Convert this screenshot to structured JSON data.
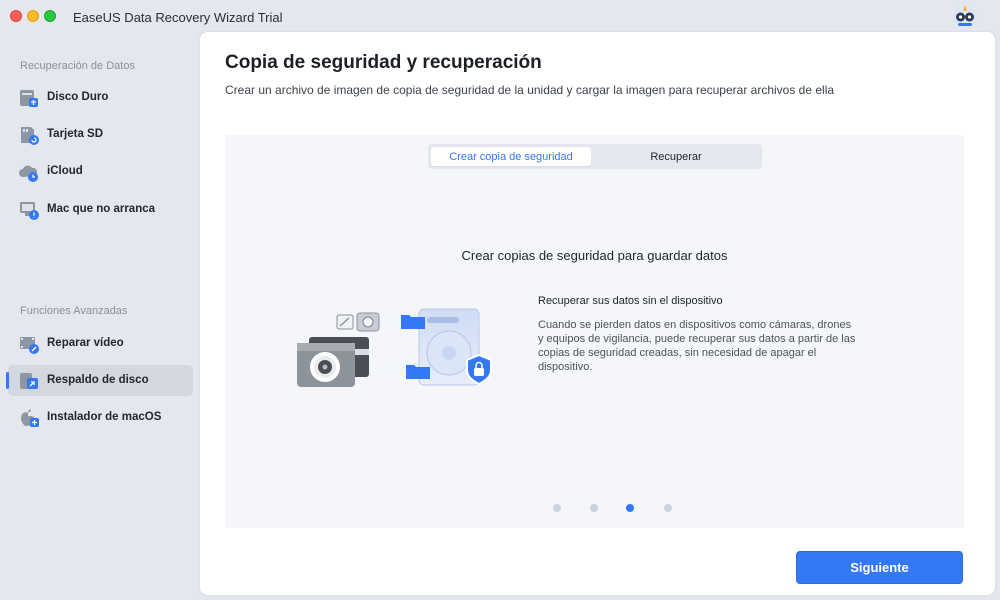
{
  "app": {
    "title": "EaseUS Data Recovery Wizard  Trial"
  },
  "sidebar": {
    "section1_title": "Recuperación de Datos",
    "items1": [
      {
        "label": "Disco Duro",
        "icon": "hard-drive-icon"
      },
      {
        "label": "Tarjeta SD",
        "icon": "sd-card-icon"
      },
      {
        "label": "iCloud",
        "icon": "icloud-icon"
      },
      {
        "label": "Mac que no arranca",
        "icon": "mac-not-boot-icon"
      }
    ],
    "section2_title": "Funciones Avanzadas",
    "items2": [
      {
        "label": "Reparar vídeo",
        "icon": "video-repair-icon"
      },
      {
        "label": "Respaldo de disco",
        "icon": "disk-backup-icon",
        "active": true
      },
      {
        "label": "Instalador de macOS",
        "icon": "macos-installer-icon"
      }
    ]
  },
  "main": {
    "title": "Copia de seguridad y recuperación",
    "subtitle": "Crear un archivo de imagen de copia de seguridad de la unidad y cargar la imagen para recuperar archivos de ella",
    "tabs": [
      {
        "label": "Crear copia de seguridad",
        "active": true
      },
      {
        "label": "Recuperar",
        "active": false
      }
    ],
    "slide": {
      "title": "Crear copias de seguridad para guardar datos",
      "feature_title": "Recuperar sus datos sin el dispositivo",
      "feature_desc": "Cuando se pierden datos en dispositivos como cámaras, drones y equipos de vigilancia, puede recuperar sus datos a partir de las copias de seguridad creadas, sin necesidad de apagar el dispositivo."
    },
    "carousel": {
      "count": 4,
      "active_index": 3
    },
    "next_label": "Siguiente"
  },
  "colors": {
    "accent": "#3478f6",
    "sidebar_bg": "#e4e8ee",
    "card_bg": "#f4f6f9"
  }
}
